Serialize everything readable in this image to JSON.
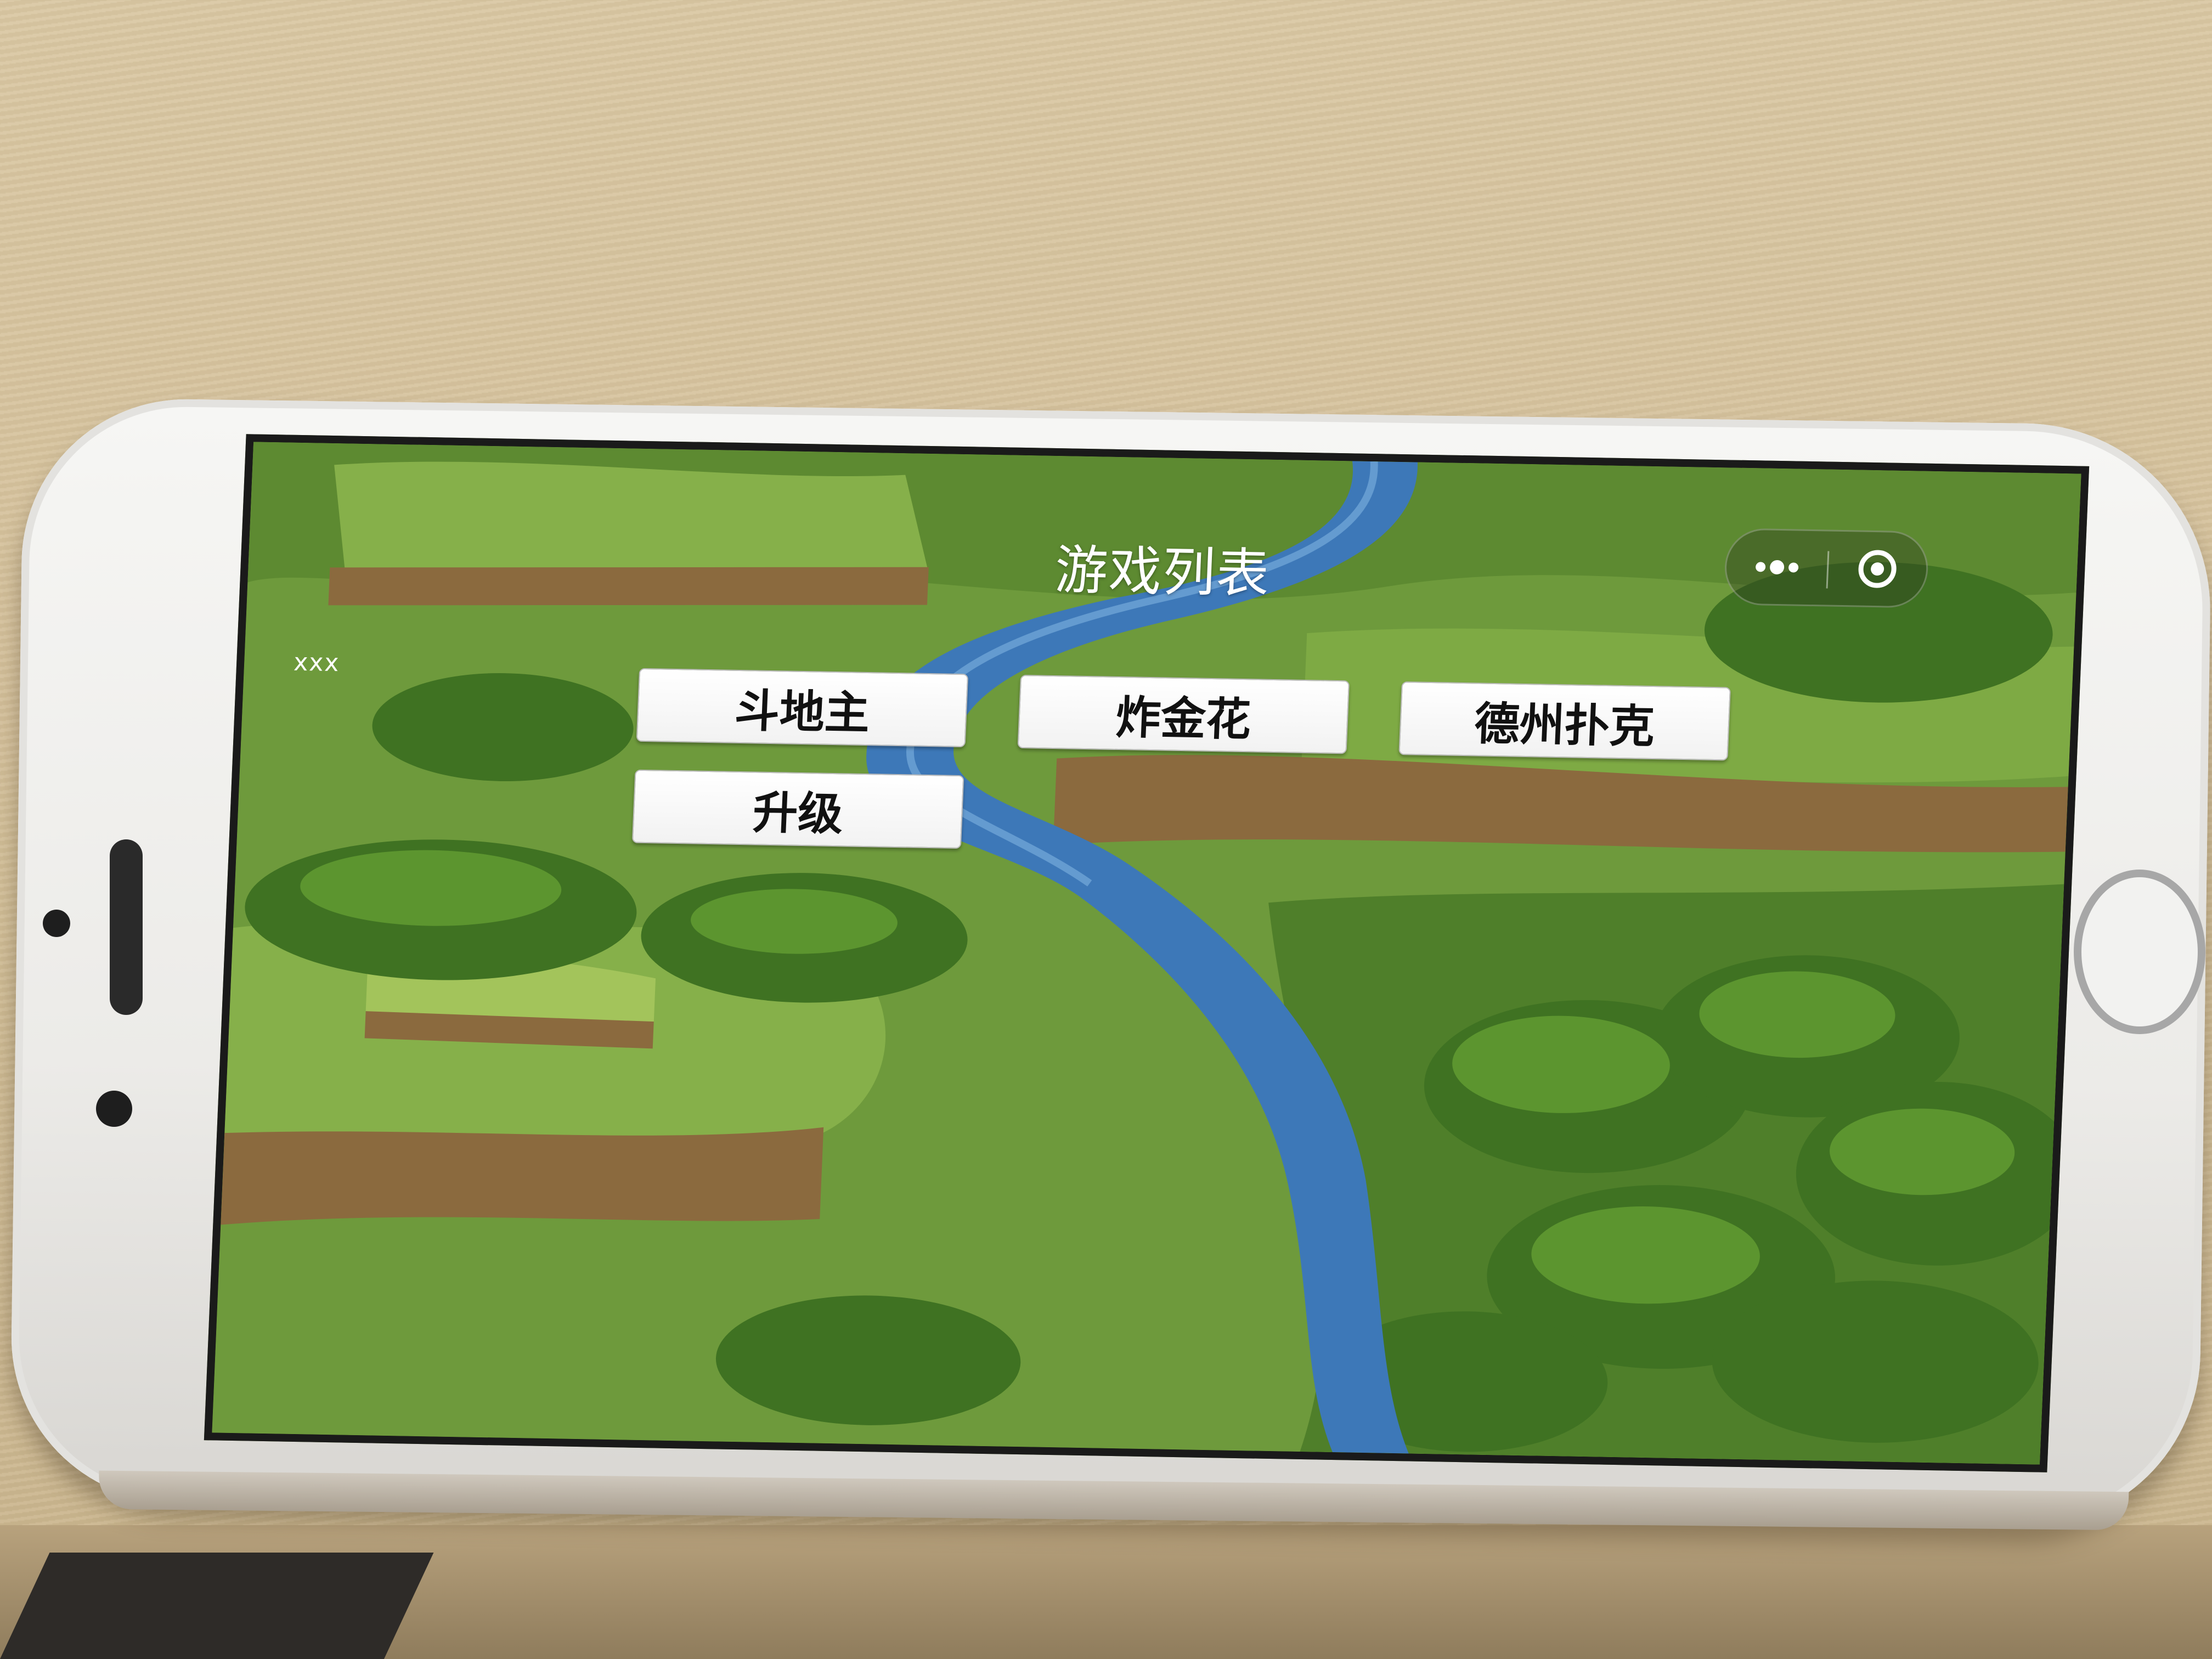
{
  "navigation_bar": {
    "title": "游戏列表",
    "capsule": {
      "more_icon": "more-dots-icon",
      "close_icon": "close-circle-icon"
    }
  },
  "user": {
    "name": "xxx"
  },
  "game_list": {
    "items": [
      {
        "label": "斗地主"
      },
      {
        "label": "炸金花"
      },
      {
        "label": "德州扑克"
      },
      {
        "label": "升级"
      }
    ]
  },
  "colors": {
    "title_text": "#ffffff",
    "button_background": "#ffffff",
    "button_text": "#111111",
    "river": "#3d78b8",
    "grass": "#6f9a3a"
  }
}
